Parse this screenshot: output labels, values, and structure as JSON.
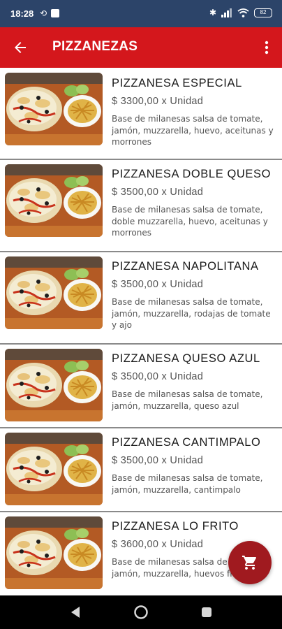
{
  "status_bar": {
    "time": "18:28",
    "battery": "82"
  },
  "app_bar": {
    "title": "PIZZANEZAS"
  },
  "products": [
    {
      "name": "PIZZANESA ESPECIAL",
      "price": "$   3300,00 x Unidad",
      "description": "Base de milanesas salsa de tomate, jamón, muzzarella, huevo, aceitunas y morrones"
    },
    {
      "name": "PIZZANESA DOBLE QUESO",
      "price": "$   3500,00 x Unidad",
      "description": "Base de milanesas salsa de tomate, doble muzzarella, huevo, aceitunas y morrones"
    },
    {
      "name": "PIZZANESA NAPOLITANA",
      "price": "$   3500,00 x Unidad",
      "description": "Base de milanesas salsa de tomate, jamón, muzzarella, rodajas de tomate y ajo"
    },
    {
      "name": "PIZZANESA QUESO AZUL",
      "price": "$   3500,00 x Unidad",
      "description": "Base de milanesas salsa de tomate, jamón, muzzarella, queso azul"
    },
    {
      "name": "PIZZANESA CANTIMPALO",
      "price": "$   3500,00 x Unidad",
      "description": "Base de milanesas salsa de tomate, jamón, muzzarella, cantimpalo"
    },
    {
      "name": "PIZZANESA LO FRITO",
      "price": "$   3600,00 x Unidad",
      "description": "Base de milanesas salsa de tomate, jamón, muzzarella, huevos fritos"
    }
  ],
  "icons": {
    "back": "arrow-back-icon",
    "overflow": "more-vert-icon",
    "cart": "shopping-cart-icon"
  },
  "colors": {
    "app_bar": "#d4171c",
    "status_bar": "#2c4469",
    "fab": "#a01a1f"
  }
}
